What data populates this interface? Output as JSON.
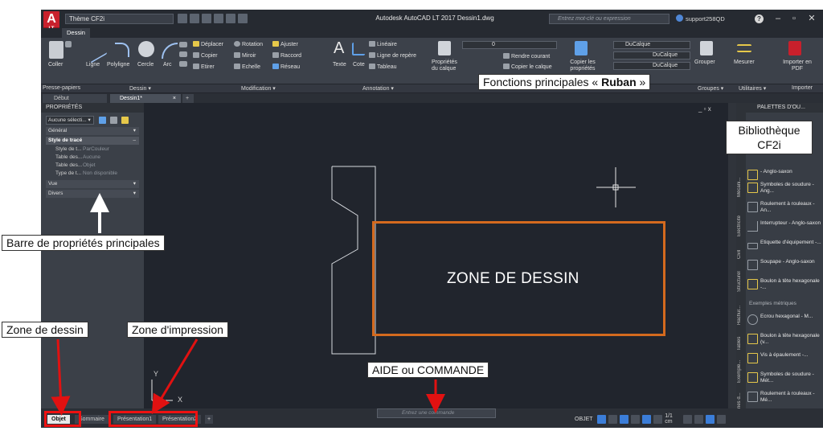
{
  "window": {
    "title": "Autodesk AutoCAD LT 2017   Dessin1.dwg",
    "workspace": "Thème CF2i",
    "search_placeholder": "Entrez mot-clé ou expression",
    "user": "support258QD",
    "logo_letter": "A",
    "logo_sub": "LT"
  },
  "ribbon": {
    "tab_active": "Dessin",
    "dessin": {
      "coller": "Coller",
      "ligne": "Ligne",
      "polyligne": "Polyligne",
      "cercle": "Cercle",
      "arc": "Arc"
    },
    "modification": {
      "deplacer": "Déplacer",
      "rotation": "Rotation",
      "ajuster": "Ajuster",
      "copier": "Copier",
      "miroir": "Miroir",
      "raccord": "Raccord",
      "etirer": "Etirer",
      "echelle": "Echelle",
      "reseau": "Réseau"
    },
    "annotation": {
      "texte": "Texte",
      "cote": "Cote",
      "lineaire": "Linéaire",
      "ligne_repere": "Ligne de repère",
      "tableau": "Tableau"
    },
    "calques": {
      "proprietes_calque": "Propriétés du calque",
      "layer_value": "0",
      "rendre_courant": "Rendre courant",
      "copier_calque": "Copier le calque"
    },
    "proprietes": {
      "copier_proprietes": "Copier les propriétés",
      "ducalque_1": "DuCalque",
      "ducalque_2": "DuCalque",
      "ducalque_3": "DuCalque"
    },
    "groupes": {
      "grouper": "Grouper"
    },
    "utilitaires": {
      "mesurer": "Mesurer"
    },
    "importer": {
      "label": "Importer en PDF"
    }
  },
  "panel_titles": {
    "presse_papiers": "Presse-papiers",
    "dessin": "Dessin ▾",
    "modification": "Modification ▾",
    "annotation": "Annotation ▾",
    "groupes": "Groupes ▾",
    "utilitaires": "Utilitaires ▾",
    "importer": "Importer"
  },
  "file_tabs": {
    "debut": "Début",
    "dessin1": "Dessin1*",
    "plus": "+"
  },
  "properties": {
    "title": "PROPRIÉTÉS",
    "selection": "Aucune sélecti...",
    "general": "Général",
    "style_de_trace": "Style de tracé",
    "rows": [
      {
        "key": "Style de t...",
        "value": "ParCouleur"
      },
      {
        "key": "Table des...",
        "value": "Aucune"
      },
      {
        "key": "Table des...",
        "value": "Objet"
      },
      {
        "key": "Type de t...",
        "value": "Non disponible"
      }
    ],
    "vue": "Vue",
    "divers": "Divers"
  },
  "canvas": {
    "window_controls": "_ ▫ x",
    "axis_y": "Y",
    "axis_x": "X"
  },
  "palettes": {
    "title": "PALETTES D'OU...",
    "side_tabs": [
      "Mécani...",
      "Electricité",
      "Civil",
      "Structurel",
      "Hachur...",
      "Tables",
      "Exemple...",
      "Lignes d..."
    ],
    "items": [
      {
        "label": "- Anglo-saxon"
      },
      {
        "label": "Symboles de soudure - Ang..."
      },
      {
        "label": "Roulement à rouleaux - An..."
      },
      {
        "label": "Interrupteur - Anglo-saxon"
      },
      {
        "label": "Etiquette d'équipement -..."
      },
      {
        "label": "Soupape - Anglo-saxon"
      },
      {
        "label": "Boulon à tête hexagonale -..."
      },
      {
        "label": "Ecrou hexagonal - M..."
      },
      {
        "label": "Boulon à tête hexagonale (v..."
      },
      {
        "label": "Vis à épaulement -..."
      },
      {
        "label": "Symboles de soudure - Mét..."
      },
      {
        "label": "Roulement à rouleaux - Mé..."
      }
    ],
    "section_metric": "Exemples métriques"
  },
  "statusbar": {
    "tabs": [
      "Objet",
      "Sommaire",
      "Présentation1",
      "Présentation2"
    ],
    "add_tab": "+",
    "cmd_placeholder": "Entrez une commande",
    "objet": "OBJET",
    "scale": "1/1 cm"
  },
  "annotations": {
    "ruban_prefix": "Fonctions principales « ",
    "ruban_bold": "Ruban",
    "ruban_suffix": " »",
    "bibliotheque": "Bibliothèque CF2i",
    "barre_proprietes": "Barre de propriétés principales",
    "zone_dessin_label": "Zone de dessin",
    "zone_impression": "Zone d'impression",
    "aide_commande": "AIDE ou COMMANDE",
    "zone_de_dessin_canvas": "ZONE DE DESSIN"
  },
  "colors": {
    "accent_orange": "#d46a1e",
    "annotation_red": "#e11111",
    "canvas_bg": "#21252d",
    "ui_dark": "#2b2f36"
  }
}
